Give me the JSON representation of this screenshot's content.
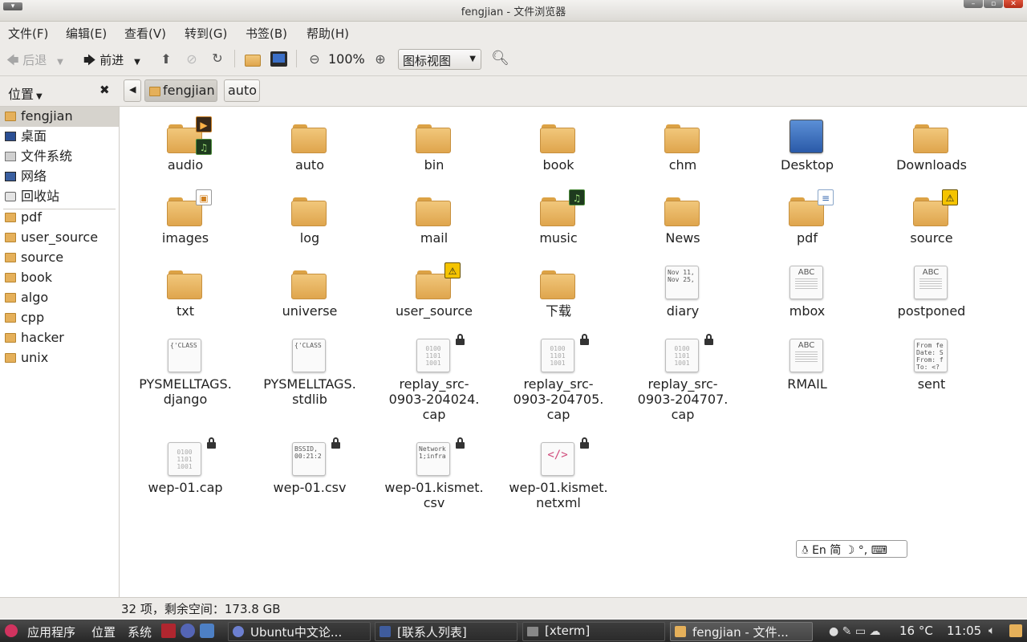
{
  "window": {
    "title": "fengjian - 文件浏览器"
  },
  "menu": [
    "文件(F)",
    "编辑(E)",
    "查看(V)",
    "转到(G)",
    "书签(B)",
    "帮助(H)"
  ],
  "toolbar": {
    "back": "后退",
    "forward": "前进",
    "zoom": "100%",
    "view_mode": "图标视图"
  },
  "location": {
    "places_label": "位置",
    "crumbs": [
      "fengjian",
      "auto"
    ]
  },
  "sidebar": {
    "places": [
      {
        "label": "fengjian",
        "icon": "home-folder-icon"
      },
      {
        "label": "桌面",
        "icon": "desktop-icon"
      },
      {
        "label": "文件系统",
        "icon": "drive-icon"
      },
      {
        "label": "网络",
        "icon": "network-icon"
      },
      {
        "label": "回收站",
        "icon": "trash-icon"
      }
    ],
    "bookmarks": [
      "pdf",
      "user_source",
      "source",
      "book",
      "algo",
      "cpp",
      "hacker",
      "unix"
    ]
  },
  "files": [
    {
      "name": "audio",
      "kind": "folder",
      "emblem": "media"
    },
    {
      "name": "auto",
      "kind": "folder"
    },
    {
      "name": "bin",
      "kind": "folder"
    },
    {
      "name": "book",
      "kind": "folder"
    },
    {
      "name": "chm",
      "kind": "folder"
    },
    {
      "name": "Desktop",
      "kind": "desktop"
    },
    {
      "name": "Downloads",
      "kind": "folder"
    },
    {
      "name": "images",
      "kind": "folder",
      "emblem": "image"
    },
    {
      "name": "log",
      "kind": "folder"
    },
    {
      "name": "mail",
      "kind": "folder"
    },
    {
      "name": "music",
      "kind": "folder",
      "emblem": "music"
    },
    {
      "name": "News",
      "kind": "folder"
    },
    {
      "name": "pdf",
      "kind": "folder",
      "emblem": "document"
    },
    {
      "name": "source",
      "kind": "folder",
      "emblem": "construction"
    },
    {
      "name": "txt",
      "kind": "folder"
    },
    {
      "name": "universe",
      "kind": "folder"
    },
    {
      "name": "user_source",
      "kind": "folder",
      "emblem": "construction"
    },
    {
      "name": "下载",
      "kind": "folder"
    },
    {
      "name": "diary",
      "kind": "text",
      "preview": "Nov 11,\nNov 25,"
    },
    {
      "name": "mbox",
      "kind": "abc"
    },
    {
      "name": "postponed",
      "kind": "abc"
    },
    {
      "name": "PYSMELLTAGS.\ndjango",
      "kind": "text",
      "preview": "{'CLASS"
    },
    {
      "name": "PYSMELLTAGS.\nstdlib",
      "kind": "text",
      "preview": "{'CLASS"
    },
    {
      "name": "replay_src-\n0903-204024.\ncap",
      "kind": "binary",
      "locked": true
    },
    {
      "name": "replay_src-\n0903-204705.\ncap",
      "kind": "binary",
      "locked": true
    },
    {
      "name": "replay_src-\n0903-204707.\ncap",
      "kind": "binary",
      "locked": true
    },
    {
      "name": "RMAIL",
      "kind": "abc"
    },
    {
      "name": "sent",
      "kind": "text",
      "preview": "From fe\nDate: S\nFrom: f\nTo: <?"
    },
    {
      "name": "wep-01.cap",
      "kind": "binary",
      "locked": true
    },
    {
      "name": "wep-01.csv",
      "kind": "text",
      "preview": "BSSID,\n00:21:2",
      "locked": true
    },
    {
      "name": "wep-01.kismet.\ncsv",
      "kind": "text",
      "preview": "Network\n1;infra",
      "locked": true
    },
    {
      "name": "wep-01.kismet.\nnetxml",
      "kind": "xml",
      "locked": true
    }
  ],
  "ime": {
    "lang": "En",
    "mode": "简"
  },
  "status": "32 项，剩余空间：173.8 GB",
  "taskbar": {
    "menus": [
      "应用程序",
      "位置",
      "系统"
    ],
    "windows": [
      "Ubuntu中文论...",
      "[联系人列表]",
      "[xterm]",
      "fengjian - 文件..."
    ],
    "temperature": "16 °C",
    "time": "11:05"
  }
}
